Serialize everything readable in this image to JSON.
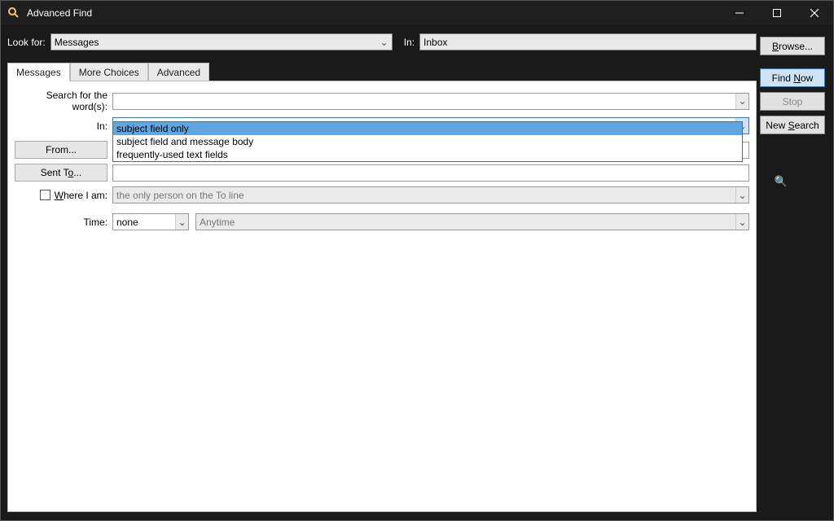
{
  "window": {
    "title": "Advanced Find"
  },
  "topbar": {
    "look_for_label": "Look for:",
    "look_for_value": "Messages",
    "in_label": "In:",
    "in_value": "Inbox",
    "browse": "Browse..."
  },
  "rightcol": {
    "find_now": "Find Now",
    "stop": "Stop",
    "new_search": "New Search"
  },
  "tabs": {
    "messages": "Messages",
    "more_choices": "More Choices",
    "advanced": "Advanced"
  },
  "form": {
    "search_words_label": "Search for the word(s):",
    "in_label": "In:",
    "in_value": "subject field only",
    "in_options": {
      "opt1": "subject field only",
      "opt2": "subject field and message body",
      "opt3": "frequently-used text fields"
    },
    "from_label": "From...",
    "sent_to_label": "Sent To...",
    "where_label": "Where I am:",
    "where_value": "the only person on the To line",
    "time_label": "Time:",
    "time_value": "none",
    "time_range": "Anytime"
  }
}
